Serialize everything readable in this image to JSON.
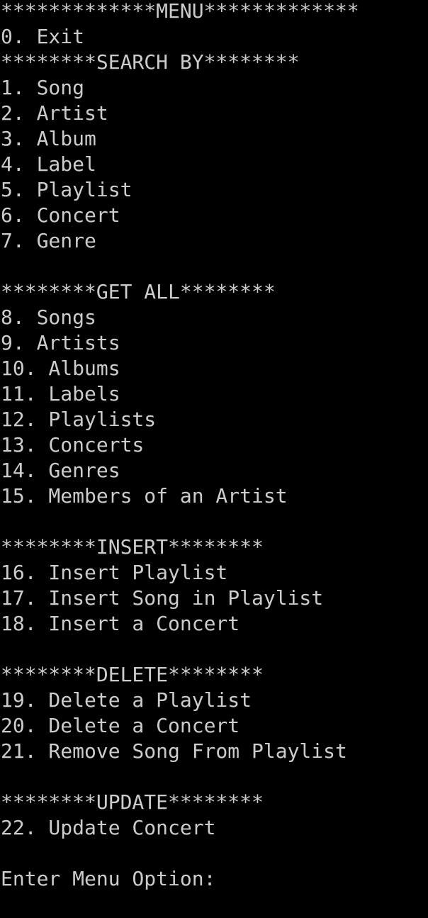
{
  "console": {
    "header": "*************MENU*************",
    "exit": "0. Exit",
    "search": {
      "heading": "********SEARCH BY********",
      "items": [
        "1. Song",
        "2. Artist",
        "3. Album",
        "4. Label",
        "5. Playlist",
        "6. Concert",
        "7. Genre"
      ]
    },
    "get_all": {
      "heading": "********GET ALL********",
      "items": [
        "8. Songs",
        "9. Artists",
        "10. Albums",
        "11. Labels",
        "12. Playlists",
        "13. Concerts",
        "14. Genres",
        "15. Members of an Artist"
      ]
    },
    "insert": {
      "heading": "********INSERT********",
      "items": [
        "16. Insert Playlist",
        "17. Insert Song in Playlist",
        "18. Insert a Concert"
      ]
    },
    "delete": {
      "heading": "********DELETE********",
      "items": [
        "19. Delete a Playlist",
        "20. Delete a Concert",
        "21. Remove Song From Playlist"
      ]
    },
    "update": {
      "heading": "********UPDATE********",
      "items": [
        "22. Update Concert"
      ]
    },
    "prompt": "Enter Menu Option:"
  },
  "colors": {
    "background": "#000000",
    "text": "#cccccc"
  }
}
